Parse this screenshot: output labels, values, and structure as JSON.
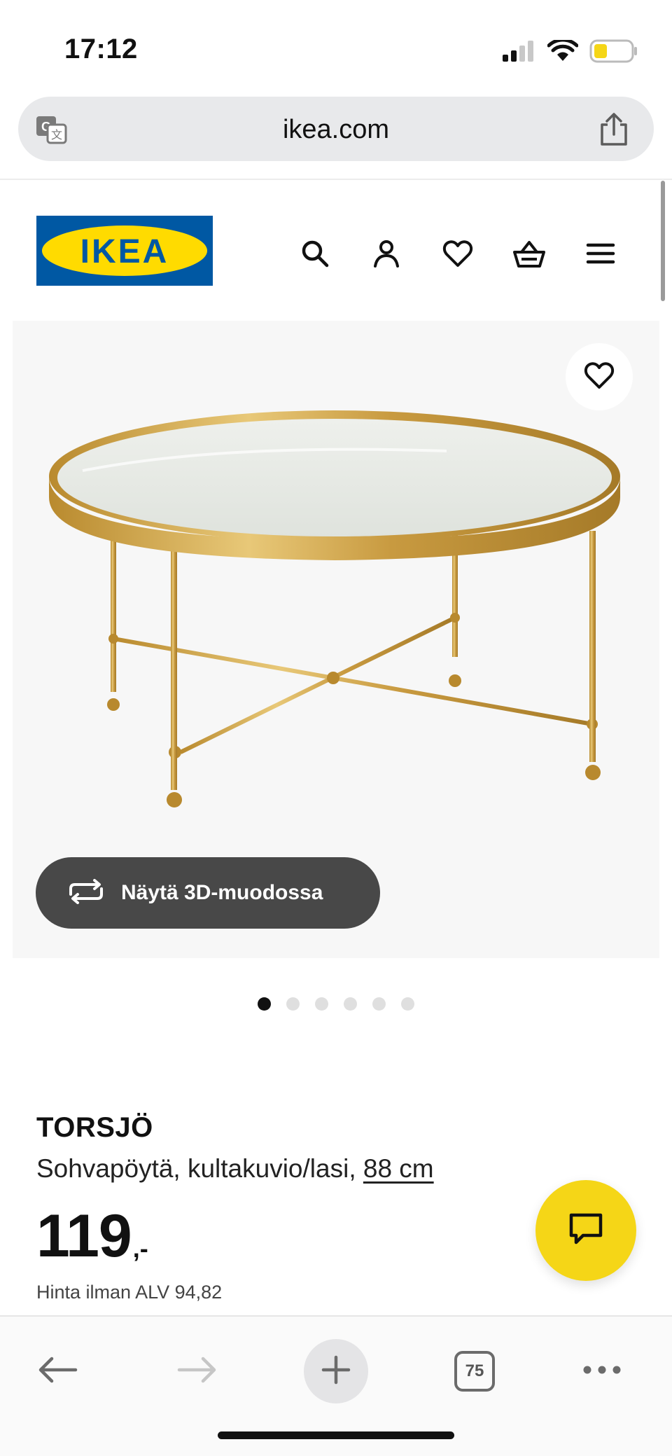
{
  "status_bar": {
    "time": "17:12",
    "signal_icon": "cellular-signal-icon",
    "wifi_icon": "wifi-icon",
    "battery_icon": "battery-low-icon",
    "battery_color": "#f5d617"
  },
  "browser": {
    "url": "ikea.com",
    "translate_icon": "translate-icon",
    "share_icon": "share-icon"
  },
  "header": {
    "logo_text": "IKEA",
    "logo_colors": {
      "blue": "#0058a3",
      "yellow": "#ffdb00"
    },
    "icons": [
      "search-icon",
      "account-icon",
      "heart-icon",
      "basket-icon",
      "menu-icon"
    ]
  },
  "product_gallery": {
    "favourite_icon": "heart-icon",
    "view_3d_label": "Näytä 3D-muodossa",
    "view_3d_icon": "rotate-3d-icon",
    "image_count": 6,
    "active_image": 1
  },
  "product": {
    "name": "TORSJÖ",
    "description": "Sohvapöytä, kultakuvio/lasi,",
    "size": "88 cm",
    "price_integer": "119",
    "price_suffix": ",-",
    "price_vat_note": "Hinta ilman ALV 94,82"
  },
  "chat": {
    "icon": "chat-icon",
    "color": "#f5d617"
  },
  "toolbar": {
    "back_icon": "back-arrow-icon",
    "forward_icon": "forward-arrow-icon",
    "new_tab_icon": "plus-icon",
    "tab_count": "75",
    "more_icon": "more-icon"
  }
}
